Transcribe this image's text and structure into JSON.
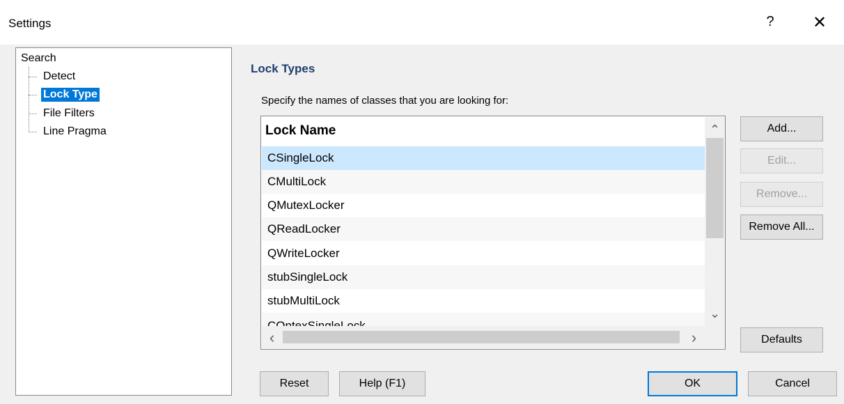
{
  "window": {
    "title": "Settings",
    "help_glyph": "?",
    "close_glyph": "✕"
  },
  "tree": {
    "root": "Search",
    "items": [
      {
        "label": "Detect",
        "selected": false
      },
      {
        "label": "Lock Type",
        "selected": true
      },
      {
        "label": "File Filters",
        "selected": false
      },
      {
        "label": "Line Pragma",
        "selected": false
      }
    ]
  },
  "panel": {
    "title": "Lock Types",
    "instructions": "Specify the names of classes that you are looking for:"
  },
  "list": {
    "header": "Lock Name",
    "rows": [
      {
        "name": "CSingleLock",
        "selected": true
      },
      {
        "name": "CMultiLock",
        "selected": false
      },
      {
        "name": "QMutexLocker",
        "selected": false
      },
      {
        "name": "QReadLocker",
        "selected": false
      },
      {
        "name": "QWriteLocker",
        "selected": false
      },
      {
        "name": "stubSingleLock",
        "selected": false
      },
      {
        "name": "stubMultiLock",
        "selected": false
      },
      {
        "name": "COntexSingleLock",
        "selected": false
      }
    ],
    "scroll_up_glyph": "⌃",
    "scroll_down_glyph": "⌄",
    "scroll_left_glyph": "‹",
    "scroll_right_glyph": "›"
  },
  "buttons": {
    "add": "Add...",
    "edit": "Edit...",
    "remove": "Remove...",
    "remove_all": "Remove All...",
    "defaults": "Defaults",
    "reset": "Reset",
    "help": "Help (F1)",
    "ok": "OK",
    "cancel": "Cancel"
  },
  "colors": {
    "selection_tree": "#0078d7",
    "selection_list": "#cce8ff",
    "section_title": "#1f3f6f"
  }
}
